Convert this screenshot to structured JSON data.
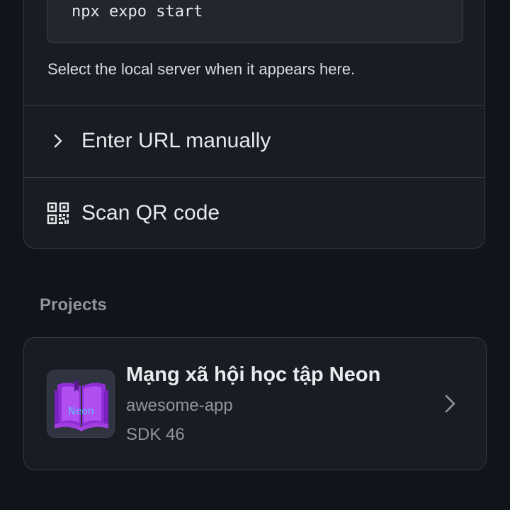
{
  "dev_server": {
    "command": "npx expo start",
    "hint": "Select the local server when it appears here.",
    "enter_url_label": "Enter URL manually",
    "scan_qr_label": "Scan QR code"
  },
  "projects": {
    "section_title": "Projects",
    "items": [
      {
        "name": "Mạng xã hội học tập Neon",
        "slug": "awesome-app",
        "sdk": "SDK 46",
        "icon_text": "Neon",
        "icon": "neon-book-icon"
      }
    ]
  },
  "colors": {
    "background": "#11141b",
    "card": "#191c23",
    "border": "#353944",
    "muted_text": "#8f949e",
    "icon_purple": "#a23ee0",
    "icon_label_blue": "#5fc0ff"
  }
}
